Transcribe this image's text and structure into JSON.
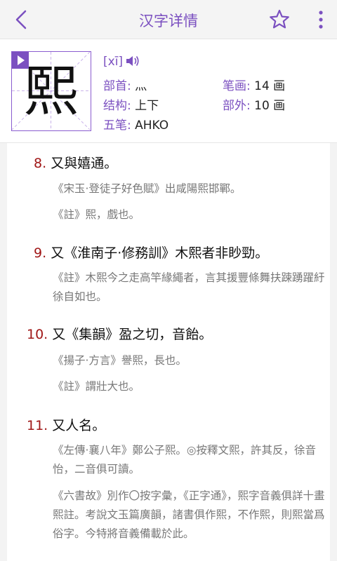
{
  "topbar": {
    "title": "汉字详情",
    "back_icon": "chevron-left-icon",
    "favorite_icon": "star-outline-icon",
    "more_icon": "vertical-dots-icon"
  },
  "character": {
    "char": "熙",
    "pinyin": "[xī]",
    "play_icon": "play-icon",
    "speaker_icon": "speaker-icon",
    "radical_label": "部首:",
    "radical_value": "灬",
    "strokes_label": "笔画:",
    "strokes_value": "14 画",
    "structure_label": "结构:",
    "structure_value": "上下",
    "outside_label": "部外:",
    "outside_value": "10 画",
    "wubi_label": "五笔:",
    "wubi_value": "AHKO"
  },
  "colors": {
    "accent": "#7b50c0",
    "entry_number": "#a01717",
    "quote_text": "#777777",
    "topbar_bg": "#f4f4f4"
  },
  "entries": [
    {
      "num": "8.",
      "text": "又與嬉通。",
      "quotes": [
        "《宋玉·登徒子好色賦》出咸陽熙邯鄲。",
        "《註》熙，戲也。"
      ]
    },
    {
      "num": "9.",
      "text": "又《淮南子·修務訓》木熙者非眇勁。",
      "quotes": [
        "《註》木熙今之走高竿緣繩者，言其援豐條舞扶踈踴躍紆徐自如也。"
      ]
    },
    {
      "num": "10.",
      "text": "又《集韻》盈之切，音飴。",
      "quotes": [
        "《揚子·方言》譽熙，長也。",
        "《註》謂壯大也。"
      ]
    },
    {
      "num": "11.",
      "text": "又人名。",
      "quotes": [
        "《左傳·襄八年》鄭公子熙。◎按釋文熙，許其反，徐音怡，二音俱可讀。",
        "《六書故》別作〇按字彙，《正字通》，熙字音義俱詳十畫熙註。考說文玉篇廣韻，諸書俱作熙，不作熙，則熙當爲俗字。今特將音義備載於此。"
      ]
    }
  ]
}
